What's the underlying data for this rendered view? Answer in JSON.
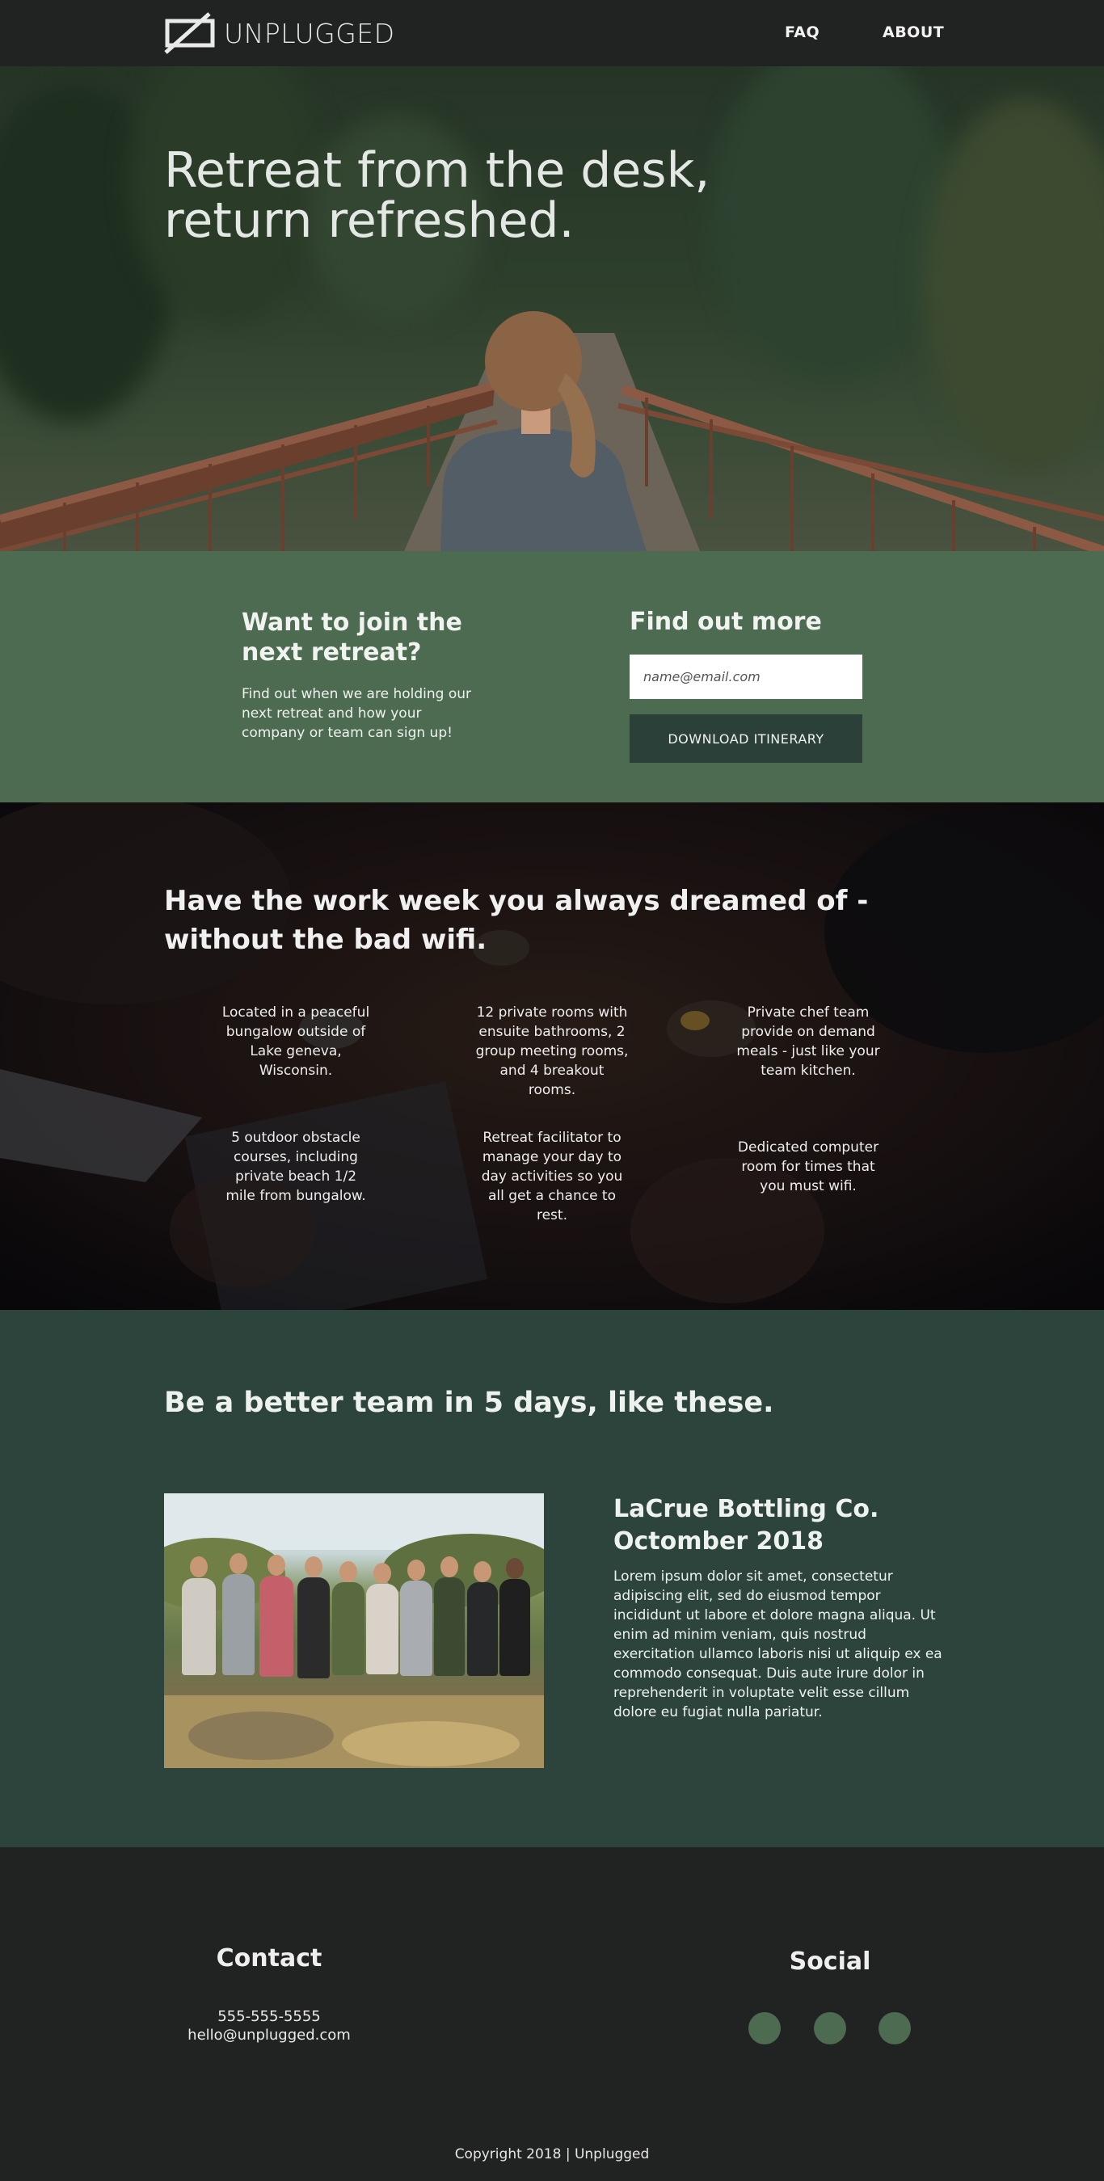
{
  "brand": {
    "name": "UNPLUGGED"
  },
  "nav": {
    "faq": "FAQ",
    "about": "ABOUT"
  },
  "hero": {
    "title_line1": "Retreat from the desk,",
    "title_line2": "return refreshed."
  },
  "signup": {
    "heading_line1": "Want to join the",
    "heading_line2": "next retreat?",
    "description": "Find out when we are holding our next retreat and how your company or team can sign up!",
    "find_heading": "Find out more",
    "email_placeholder": "name@email.com",
    "download_label": "DOWNLOAD ITINERARY"
  },
  "features": {
    "title_line1": "Have the work week you always dreamed of -",
    "title_line2": "without the bad wifi.",
    "items": [
      "Located in a peaceful bungalow outside of Lake geneva, Wisconsin.",
      "12 private rooms with ensuite bathrooms, 2 group meeting rooms, and 4 breakout rooms.",
      "Private chef team provide on demand meals - just like your team kitchen.",
      "5 outdoor obstacle courses, including private beach 1/2 mile from bungalow.",
      "Retreat facilitator to manage your day to day activities so you all get a chance to rest.",
      "Dedicated computer room for times that you must wifi."
    ]
  },
  "teams": {
    "title": "Be a better team in 5 days, like these.",
    "case_name": "LaCrue Bottling Co.",
    "case_date": "Octomber 2018",
    "case_body": "Lorem ipsum dolor sit amet, consectetur adipiscing elit, sed do eiusmod tempor incididunt ut labore et dolore magna aliqua. Ut enim ad minim veniam, quis nostrud exercitation ullamco laboris nisi ut aliquip ex ea commodo consequat. Duis aute irure dolor in reprehenderit in voluptate velit esse cillum dolore eu fugiat nulla pariatur."
  },
  "footer": {
    "contact_heading": "Contact",
    "phone": "555-555-5555",
    "email": "hello@unplugged.com",
    "social_heading": "Social",
    "social_icons": [
      "social-icon-1",
      "social-icon-2",
      "social-icon-3"
    ],
    "copyright": "Copyright 2018 | Unplugged"
  },
  "colors": {
    "nav_bg": "#212322",
    "signup_green": "#4d6b51",
    "button_dark": "#2b4038",
    "teams_bg": "#2c443c",
    "social_dot": "#4d6b51"
  }
}
